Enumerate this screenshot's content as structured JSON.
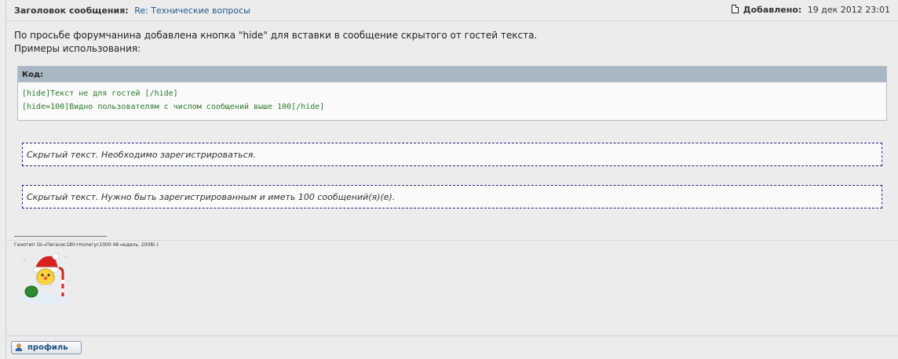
{
  "header": {
    "subject_label": "Заголовок сообщения:",
    "subject_value": "Re: Технические вопросы",
    "added_label": "Добавлено:",
    "added_value": "19 дек 2012 23:01",
    "icon": "post-icon"
  },
  "post": {
    "lines": [
      "По просьбе форумчанина добавлена кнопка \"hide\" для вставки в сообщение скрытого от гостей текста.",
      "Примеры использования:"
    ],
    "code": {
      "label": "Код:",
      "lines": [
        "[hide]Текст не для гостей [/hide]",
        "[hide=100]Видно пользователям с числом сообщений выше 100[/hide]"
      ]
    },
    "hidden_blocks": [
      "Скрытый текст. Необходимо зарегистрироваться.",
      "Скрытый текст. Нужно быть зарегистрированным и иметь 100 сообщений(я)(е)."
    ]
  },
  "signature": {
    "text": "Генотип 1b→Пегасис180+Копегус1000 48 недель. 2008(-)",
    "image": "santa-smiley-icon"
  },
  "footer": {
    "profile_label": "профиль",
    "profile_icon": "profile-icon"
  },
  "colors": {
    "background": "#ececec",
    "link": "#1f5a8a",
    "code_text": "#2a7a2a",
    "code_header": "#a9b7c4",
    "hidden_border": "#22237a"
  }
}
